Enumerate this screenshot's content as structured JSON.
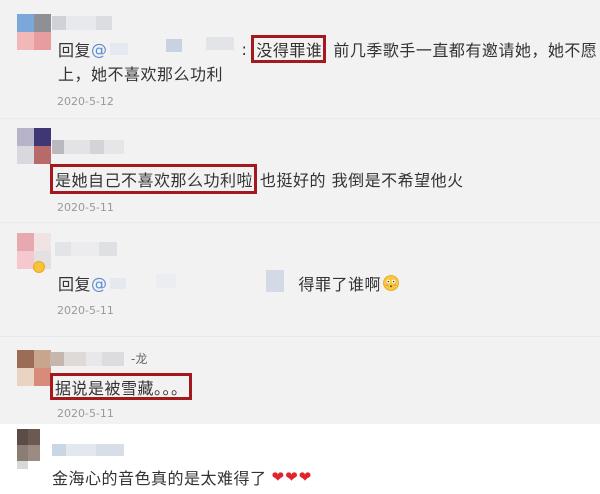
{
  "colors": {
    "list_background": "#f2f2f2",
    "highlight_box": "#a3191d",
    "mention": "#5a8bd1",
    "date": "#999999",
    "heart": "#e0242b"
  },
  "comments": [
    {
      "reply_label": "回复",
      "mention_symbol": "@",
      "separator": ":",
      "highlight": "没得罪谁",
      "text": "前几季歌手一直都有邀请她，她不愿",
      "text_continued": "上，她不喜欢那么功利",
      "date": "2020-5-12"
    },
    {
      "highlight": "是她自己不喜欢那么功利啦",
      "text": "也挺好的 我倒是不希望他火",
      "date": "2020-5-11"
    },
    {
      "reply_label": "回复",
      "mention_symbol": "@",
      "text": "得罪了谁啊",
      "emoji": "flushed-face-icon",
      "date": "2020-5-11"
    },
    {
      "username_visible": "-龙",
      "highlight": "据说是被雪藏。。。",
      "date": "2020-5-11"
    },
    {
      "text": "金海心的音色真的是太难得了",
      "hearts": "❤❤❤"
    }
  ]
}
